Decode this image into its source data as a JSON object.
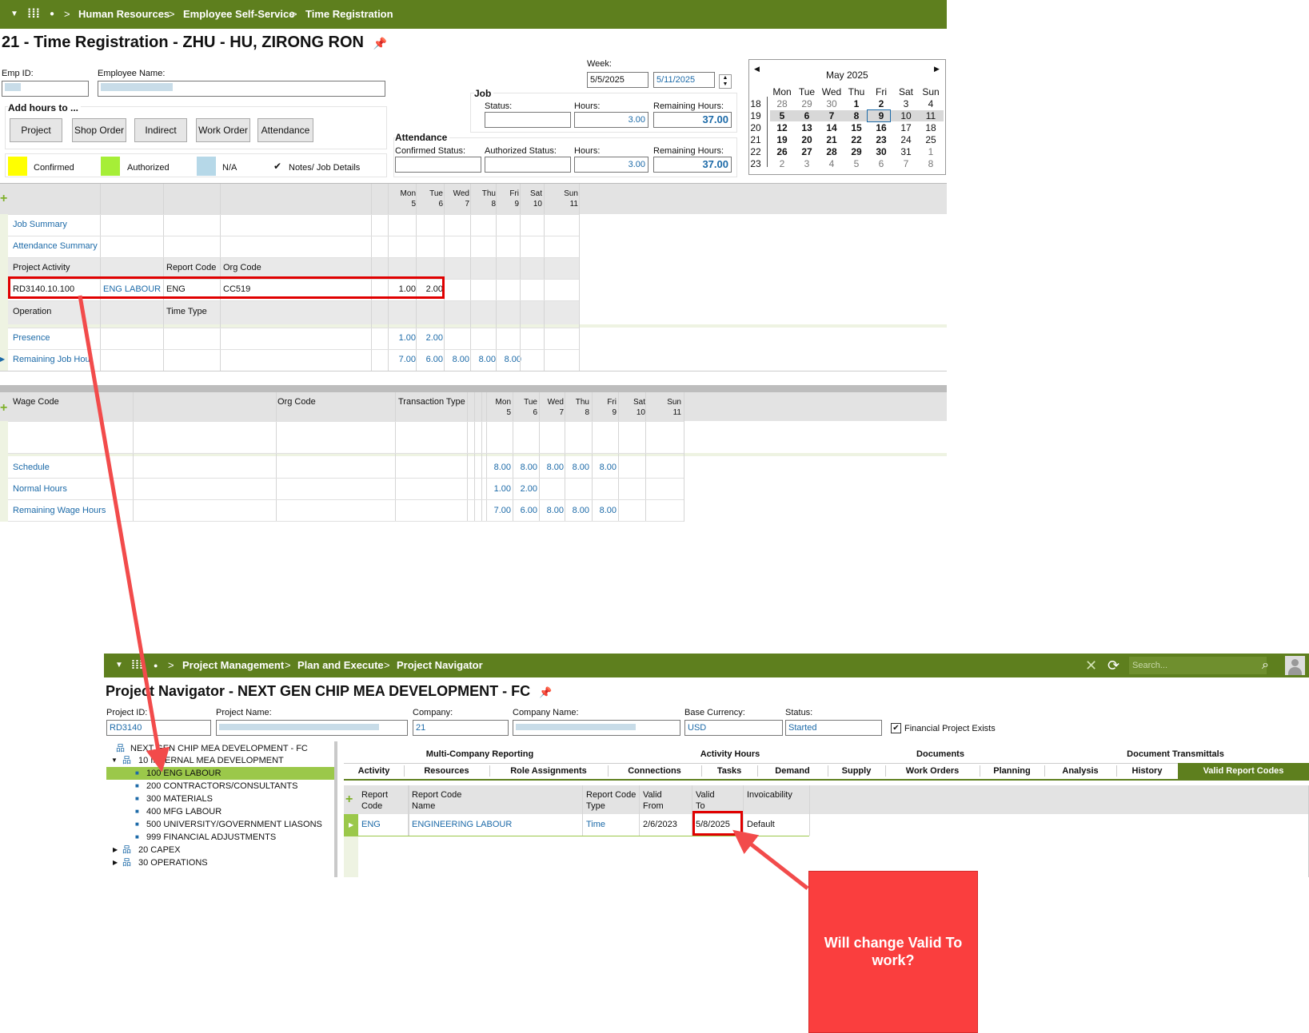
{
  "top_nav": {
    "breadcrumb": [
      "Human Resources",
      "Employee Self-Service",
      "Time Registration"
    ]
  },
  "time_reg": {
    "title": "21 - Time Registration - ZHU - HU, ZIRONG RON",
    "emp_id_label": "Emp ID:",
    "emp_name_label": "Employee Name:",
    "add_hours_label": "Add hours to ...",
    "buttons": [
      "Project",
      "Shop Order",
      "Indirect",
      "Work Order",
      "Attendance"
    ],
    "legend": {
      "confirmed": "Confirmed",
      "authorized": "Authorized",
      "na": "N/A",
      "notes": "Notes/ Job Details",
      "confirmed_color": "#ffff00",
      "authorized_color": "#a6ee37",
      "na_color": "#b6d8e8"
    },
    "week_label": "Week:",
    "week_from": "5/5/2025",
    "week_to": "5/11/2025",
    "job": {
      "label": "Job",
      "status_label": "Status:",
      "hours_label": "Hours:",
      "hours_value": "3.00",
      "remaining_label": "Remaining Hours:",
      "remaining_value": "37.00"
    },
    "attendance": {
      "label": "Attendance",
      "confirmed_status_label": "Confirmed Status:",
      "authorized_status_label": "Authorized Status:",
      "hours_label": "Hours:",
      "hours_value": "3.00",
      "remaining_label": "Remaining Hours:",
      "remaining_value": "37.00"
    },
    "calendar": {
      "month": "May 2025",
      "days": [
        "Mon",
        "Tue",
        "Wed",
        "Thu",
        "Fri",
        "Sat",
        "Sun"
      ],
      "weeks": [
        {
          "wk": "18",
          "d": [
            "28",
            "29",
            "30",
            "1",
            "2",
            "3",
            "4"
          ]
        },
        {
          "wk": "19",
          "d": [
            "5",
            "6",
            "7",
            "8",
            "9",
            "10",
            "11"
          ]
        },
        {
          "wk": "20",
          "d": [
            "12",
            "13",
            "14",
            "15",
            "16",
            "17",
            "18"
          ]
        },
        {
          "wk": "21",
          "d": [
            "19",
            "20",
            "21",
            "22",
            "23",
            "24",
            "25"
          ]
        },
        {
          "wk": "22",
          "d": [
            "26",
            "27",
            "28",
            "29",
            "30",
            "31",
            "1"
          ]
        },
        {
          "wk": "23",
          "d": [
            "2",
            "3",
            "4",
            "5",
            "6",
            "7",
            "8"
          ]
        }
      ]
    },
    "job_grid": {
      "day_heads": [
        {
          "d": "Mon",
          "n": "5"
        },
        {
          "d": "Tue",
          "n": "6"
        },
        {
          "d": "Wed",
          "n": "7"
        },
        {
          "d": "Thu",
          "n": "8"
        },
        {
          "d": "Fri",
          "n": "9"
        },
        {
          "d": "Sat",
          "n": "10"
        },
        {
          "d": "Sun",
          "n": "11"
        }
      ],
      "job_summary": "Job Summary",
      "attendance_summary": "Attendance Summary",
      "project_activity_label": "Project Activity",
      "report_code_label": "Report Code",
      "org_code_label": "Org Code",
      "row": {
        "activity": "RD3140.10.100",
        "name": "ENG LABOUR",
        "report_code": "ENG",
        "org_code": "CC519",
        "mon": "1.00",
        "tue": "2.00"
      },
      "operation_label": "Operation",
      "time_type_label": "Time Type",
      "presence": {
        "label": "Presence",
        "values": [
          "1.00",
          "2.00"
        ]
      },
      "remaining": {
        "label": "Remaining Job Hours",
        "values": [
          "7.00",
          "6.00",
          "8.00",
          "8.00",
          "8.00"
        ]
      }
    },
    "wage_grid": {
      "wage_code_label": "Wage Code",
      "org_code_label": "Org Code",
      "transaction_type_label": "Transaction Type",
      "day_heads": [
        {
          "d": "Mon",
          "n": "5"
        },
        {
          "d": "Tue",
          "n": "6"
        },
        {
          "d": "Wed",
          "n": "7"
        },
        {
          "d": "Thu",
          "n": "8"
        },
        {
          "d": "Fri",
          "n": "9"
        },
        {
          "d": "Sat",
          "n": "10"
        },
        {
          "d": "Sun",
          "n": "11"
        }
      ],
      "schedule": {
        "label": "Schedule",
        "values": [
          "8.00",
          "8.00",
          "8.00",
          "8.00",
          "8.00"
        ]
      },
      "normal": {
        "label": "Normal Hours",
        "values": [
          "1.00",
          "2.00"
        ]
      },
      "remaining": {
        "label": "Remaining Wage Hours",
        "values": [
          "7.00",
          "6.00",
          "8.00",
          "8.00",
          "8.00"
        ]
      }
    }
  },
  "project_nav": {
    "breadcrumb": [
      "Project Management",
      "Plan and Execute",
      "Project Navigator"
    ],
    "search_placeholder": "Search...",
    "title": "Project Navigator - NEXT GEN CHIP MEA DEVELOPMENT - FC",
    "fields": {
      "project_id_label": "Project ID:",
      "project_id": "RD3140",
      "project_name_label": "Project Name:",
      "company_label": "Company:",
      "company": "21",
      "company_name_label": "Company Name:",
      "base_currency_label": "Base Currency:",
      "base_currency": "USD",
      "status_label": "Status:",
      "status": "Started",
      "financial_label": "Financial Project Exists"
    },
    "tree": [
      "NEXT GEN CHIP MEA DEVELOPMENT - FC",
      "10 INTERNAL MEA DEVELOPMENT",
      "100 ENG LABOUR",
      "200 CONTRACTORS/CONSULTANTS",
      "300 MATERIALS",
      "400 MFG LABOUR",
      "500 UNIVERSITY/GOVERNMENT LIASONS",
      "999 FINANCIAL ADJUSTMENTS",
      "20 CAPEX",
      "30 OPERATIONS"
    ],
    "tabs_row1": [
      "Multi-Company Reporting",
      "Activity Hours",
      "Documents",
      "Document Transmittals"
    ],
    "tabs_row2": [
      "Activity",
      "Resources",
      "Role Assignments",
      "Connections",
      "Tasks",
      "Demand",
      "Supply",
      "Work Orders",
      "Planning",
      "Analysis",
      "History",
      "Valid Report Codes"
    ],
    "table": {
      "headers": [
        "Report Code",
        "Report Code Name",
        "Report Code Type",
        "Valid From",
        "Valid To",
        "Invoicability"
      ],
      "row": [
        "ENG",
        "ENGINEERING LABOUR",
        "Time",
        "2/6/2023",
        "5/8/2025",
        "Default"
      ]
    }
  },
  "callout": {
    "text": "Will change Valid To work?",
    "color": "#fa3e3e",
    "highlight_color": "#e00000"
  }
}
